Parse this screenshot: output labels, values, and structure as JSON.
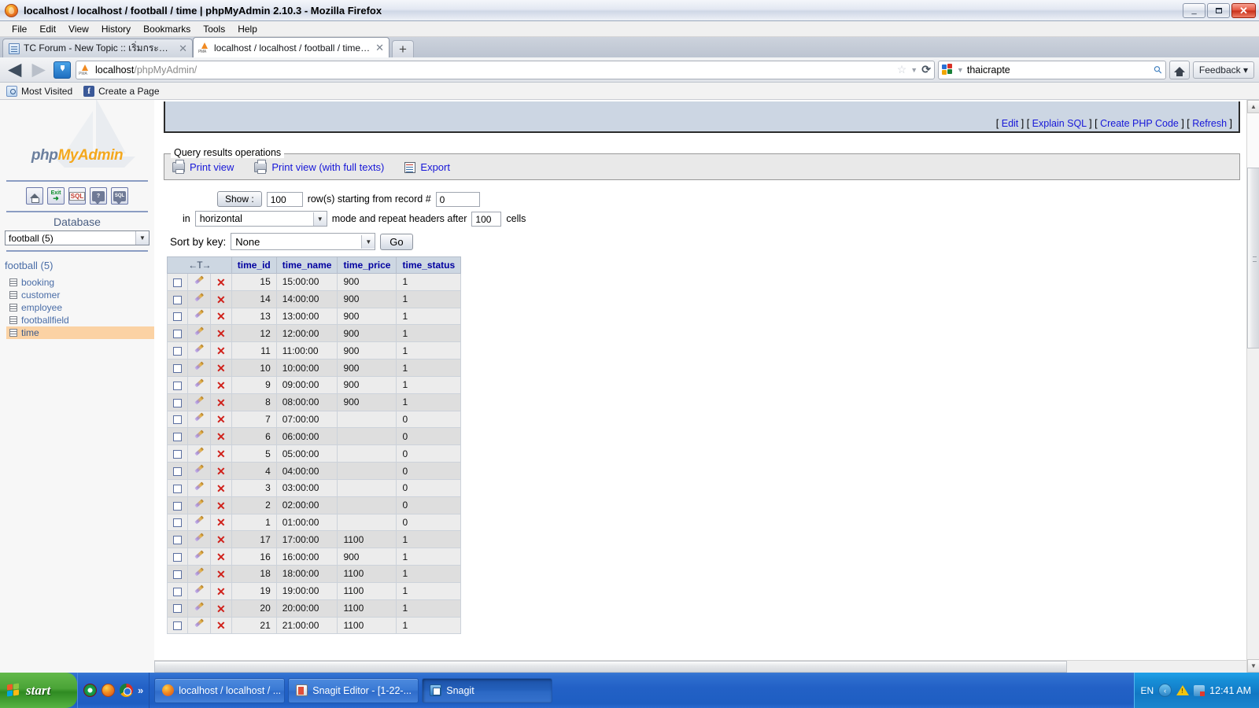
{
  "window": {
    "title": "localhost / localhost / football / time  |  phpMyAdmin 2.10.3 - Mozilla Firefox",
    "minimize_label": "_",
    "maximize_label": "",
    "close_label": "✕"
  },
  "menubar": {
    "items": [
      "File",
      "Edit",
      "View",
      "History",
      "Bookmarks",
      "Tools",
      "Help"
    ]
  },
  "tabs": [
    {
      "label": "TC Forum - New Topic :: เริ่มกระทู้ใหม่",
      "icon": "forum-icon",
      "active": false,
      "close": "✕"
    },
    {
      "label": "localhost / localhost / football / time | php...",
      "icon": "phpmyadmin-icon",
      "active": true,
      "close": "✕"
    }
  ],
  "new_tab_label": "+",
  "toolbar": {
    "back_label": "◀",
    "forward_label": "▶",
    "url_host": "localhost",
    "url_path": "/phpMyAdmin/",
    "star_label": "☆",
    "caret_label": "▼",
    "reload_label": "⟳",
    "search_value": "thaicrapte",
    "search_caret": "▼",
    "magnify_label": "⚲",
    "home_label": "home-icon",
    "feedback_label": "Feedback",
    "feedback_caret": "▾"
  },
  "bookmarks": [
    {
      "label": "Most Visited",
      "icon": "most-visited-icon"
    },
    {
      "label": "Create a Page",
      "icon": "facebook-icon"
    }
  ],
  "sidebar": {
    "logo_php": "php",
    "logo_myadmin": "MyAdmin",
    "nav_icons": [
      "home-icon",
      "exit-icon",
      "sql-query-icon",
      "query-window-icon",
      "sql-history-icon"
    ],
    "exit_label": "Exit",
    "sql_label": "SQL",
    "bubble_label": "?",
    "bubble2_label": "SQL",
    "database_heading": "Database",
    "database_selected": "football (5)",
    "database_caret": "▼",
    "db_name": "football (5)",
    "tables": [
      {
        "label": "booking",
        "active": false
      },
      {
        "label": "customer",
        "active": false
      },
      {
        "label": "employee",
        "active": false
      },
      {
        "label": "footballfield",
        "active": false
      },
      {
        "label": "time",
        "active": true
      }
    ]
  },
  "sql_box": {
    "links": [
      {
        "label": "Edit"
      },
      {
        "label": "Explain SQL"
      },
      {
        "label": "Create PHP Code"
      },
      {
        "label": "Refresh"
      }
    ]
  },
  "query_results": {
    "legend": "Query results operations",
    "operations": [
      {
        "label": "Print view",
        "icon": "printer-icon"
      },
      {
        "label": "Print view (with full texts)",
        "icon": "printer-icon"
      },
      {
        "label": "Export",
        "icon": "export-icon"
      }
    ]
  },
  "controls": {
    "show_button": "Show :",
    "rows_value": "100",
    "rows_label": "row(s) starting from record #",
    "record_value": "0",
    "in_label": "in",
    "mode_value": "horizontal",
    "mode_caret": "▼",
    "mode_label": "mode and repeat headers after",
    "cells_value": "100",
    "cells_label": "cells",
    "sort_label": "Sort by key:",
    "sort_value": "None",
    "sort_caret": "▼",
    "go_button": "Go"
  },
  "table": {
    "action_header": "←T→",
    "columns": [
      "time_id",
      "time_name",
      "time_price",
      "time_status"
    ],
    "rows": [
      {
        "time_id": "15",
        "time_name": "15:00:00",
        "time_price": "900",
        "time_status": "1"
      },
      {
        "time_id": "14",
        "time_name": "14:00:00",
        "time_price": "900",
        "time_status": "1"
      },
      {
        "time_id": "13",
        "time_name": "13:00:00",
        "time_price": "900",
        "time_status": "1"
      },
      {
        "time_id": "12",
        "time_name": "12:00:00",
        "time_price": "900",
        "time_status": "1"
      },
      {
        "time_id": "11",
        "time_name": "11:00:00",
        "time_price": "900",
        "time_status": "1"
      },
      {
        "time_id": "10",
        "time_name": "10:00:00",
        "time_price": "900",
        "time_status": "1"
      },
      {
        "time_id": "9",
        "time_name": "09:00:00",
        "time_price": "900",
        "time_status": "1"
      },
      {
        "time_id": "8",
        "time_name": "08:00:00",
        "time_price": "900",
        "time_status": "1"
      },
      {
        "time_id": "7",
        "time_name": "07:00:00",
        "time_price": "",
        "time_status": "0"
      },
      {
        "time_id": "6",
        "time_name": "06:00:00",
        "time_price": "",
        "time_status": "0"
      },
      {
        "time_id": "5",
        "time_name": "05:00:00",
        "time_price": "",
        "time_status": "0"
      },
      {
        "time_id": "4",
        "time_name": "04:00:00",
        "time_price": "",
        "time_status": "0"
      },
      {
        "time_id": "3",
        "time_name": "03:00:00",
        "time_price": "",
        "time_status": "0"
      },
      {
        "time_id": "2",
        "time_name": "02:00:00",
        "time_price": "",
        "time_status": "0"
      },
      {
        "time_id": "1",
        "time_name": "01:00:00",
        "time_price": "",
        "time_status": "0"
      },
      {
        "time_id": "17",
        "time_name": "17:00:00",
        "time_price": "1100",
        "time_status": "1"
      },
      {
        "time_id": "16",
        "time_name": "16:00:00",
        "time_price": "900",
        "time_status": "1"
      },
      {
        "time_id": "18",
        "time_name": "18:00:00",
        "time_price": "1100",
        "time_status": "1"
      },
      {
        "time_id": "19",
        "time_name": "19:00:00",
        "time_price": "1100",
        "time_status": "1"
      },
      {
        "time_id": "20",
        "time_name": "20:00:00",
        "time_price": "1100",
        "time_status": "1"
      },
      {
        "time_id": "21",
        "time_name": "21:00:00",
        "time_price": "1100",
        "time_status": "1"
      }
    ],
    "edit_icon": "pencil-icon",
    "delete_icon": "delete-x-icon"
  },
  "taskbar": {
    "start_label": "start",
    "quicklaunch": [
      "opera-icon",
      "firefox-icon",
      "chrome-icon"
    ],
    "more_label": "»",
    "tasks": [
      {
        "label": "localhost / localhost / ...",
        "icon": "firefox-icon",
        "pressed": false
      },
      {
        "label": "Snagit Editor - [1-22-...",
        "icon": "snagit-editor-icon",
        "pressed": false
      },
      {
        "label": "Snagit",
        "icon": "snagit-icon",
        "pressed": true
      }
    ],
    "tray_language": "EN",
    "tray_chevron": "‹",
    "tray_icons": [
      "warning-icon",
      "user-accounts-icon"
    ],
    "clock": "12:41 AM"
  },
  "colors": {
    "link": "#1717d8",
    "header_text": "#0000a0",
    "table_header_bg": "#cdd7e2",
    "active_table": "#fbd2a4",
    "taskbar_blue": "#2361c6",
    "start_green": "#4aa336"
  }
}
